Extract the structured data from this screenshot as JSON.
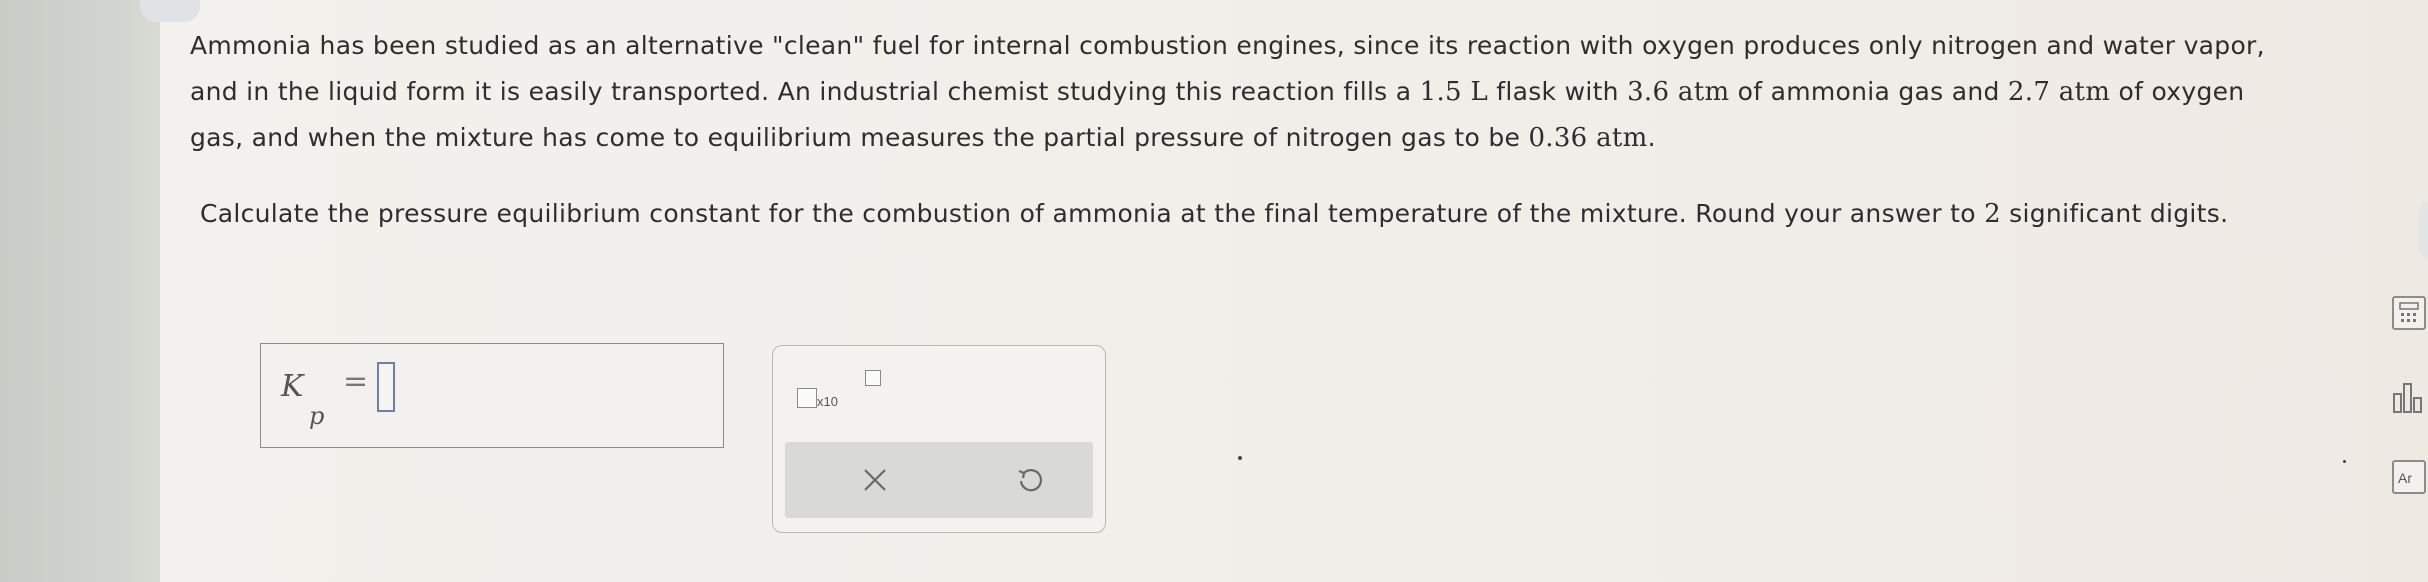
{
  "problem": {
    "para1": {
      "line1": "Ammonia has been studied as an alternative \"clean\" fuel for internal combustion engines, since its reaction with oxygen produces only nitrogen and water vapor,",
      "line2_a": "and in the liquid form it is easily transported. An industrial chemist studying this reaction fills a ",
      "volume": "1.5 L",
      "line2_b": " flask with ",
      "nh3_pressure": "3.6 atm",
      "line2_c": " of ammonia gas and ",
      "o2_pressure": "2.7 atm",
      "line2_d": " of oxygen",
      "line3_a": "gas, and when the mixture has come to equilibrium measures the partial pressure of nitrogen gas to be ",
      "n2_pressure": "0.36 atm",
      "line3_b": "."
    },
    "para2": {
      "text_a": "Calculate the pressure equilibrium constant for the combustion of ammonia at the final temperature of the mixture. Round your answer to ",
      "sig_figs": "2",
      "text_b": " significant digits."
    }
  },
  "answer": {
    "symbol": "K",
    "subscript": "p",
    "equals": "="
  },
  "tools": {
    "sci_notation_label": "x10",
    "clear_icon": "close-icon",
    "undo_icon": "undo-icon"
  },
  "right_tools": {
    "calculator_icon": "calculator-icon",
    "chart_icon": "data-chart-icon",
    "periodic_label": "Ar"
  },
  "colors": {
    "text": "#2e2e2e",
    "background": "#f1eeea",
    "input_cursor": "#6d7fb0"
  }
}
